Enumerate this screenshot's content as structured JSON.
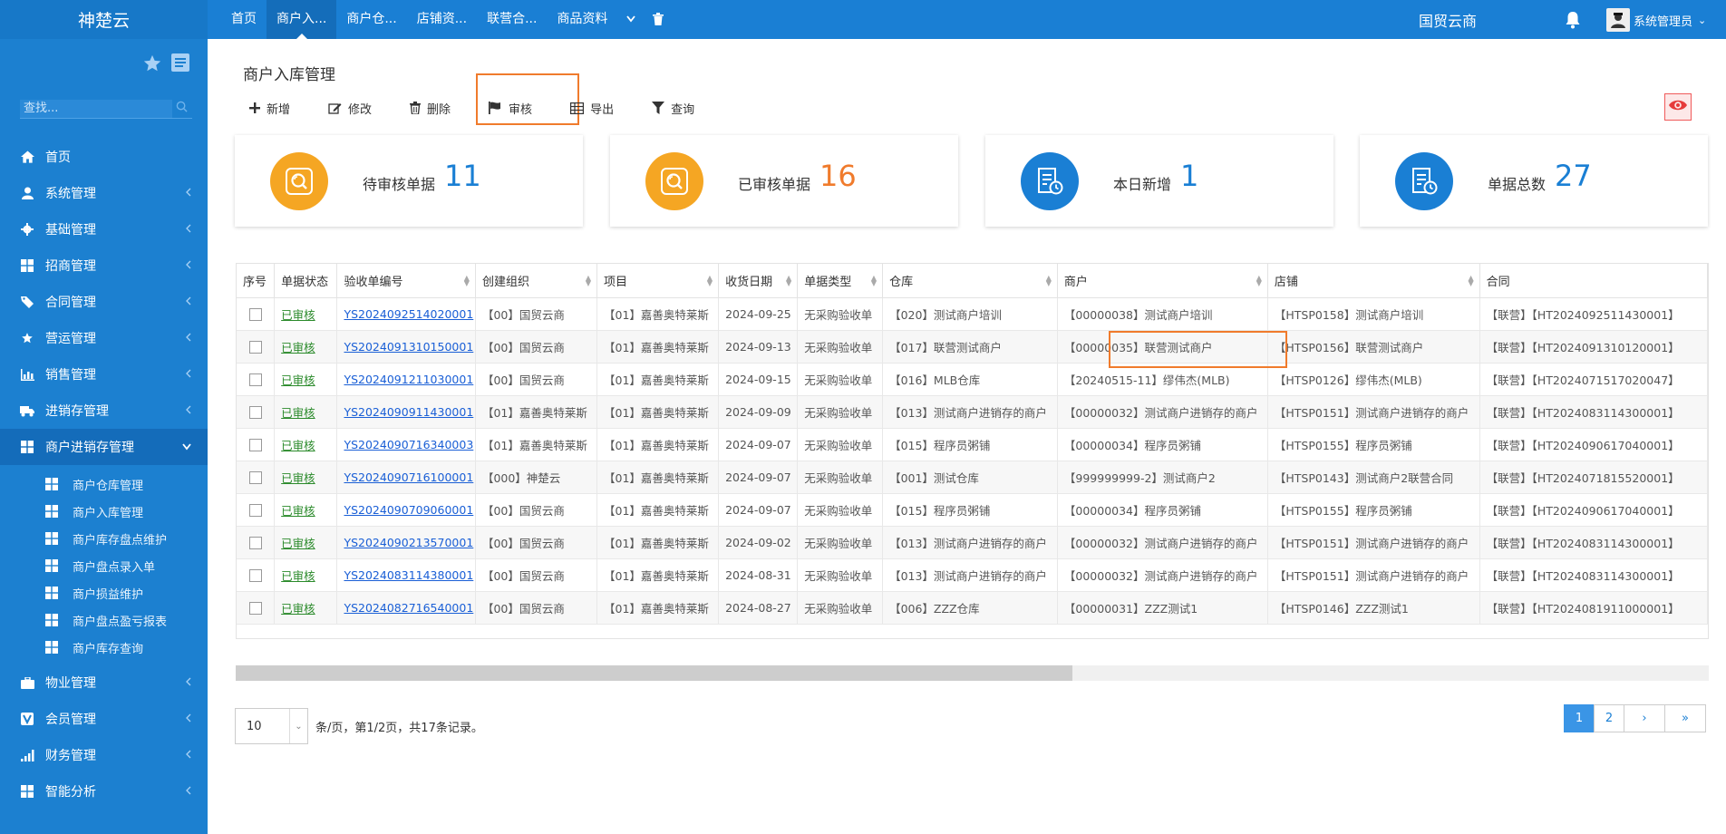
{
  "app": {
    "brand": "神楚云",
    "company": "国贸云商",
    "user": "系统管理员"
  },
  "topnav": {
    "tabs": [
      "首页",
      "商户入...",
      "商户仓...",
      "店铺资...",
      "联营合...",
      "商品资料"
    ],
    "active_index": 1
  },
  "sidebar": {
    "search_placeholder": "查找...",
    "menu": [
      {
        "label": "首页",
        "icon": "home-icon"
      },
      {
        "label": "系统管理",
        "icon": "user-icon"
      },
      {
        "label": "基础管理",
        "icon": "gear-icon"
      },
      {
        "label": "招商管理",
        "icon": "windows-icon"
      },
      {
        "label": "合同管理",
        "icon": "tag-icon"
      },
      {
        "label": "营运管理",
        "icon": "star-icon"
      },
      {
        "label": "销售管理",
        "icon": "bar-chart-icon"
      },
      {
        "label": "进销存管理",
        "icon": "truck-icon"
      },
      {
        "label": "商户进销存管理",
        "icon": "windows-icon"
      }
    ],
    "submenu": [
      "商户仓库管理",
      "商户入库管理",
      "商户库存盘点维护",
      "商户盘点录入单",
      "商户损益维护",
      "商户盘点盈亏报表",
      "商户库存查询"
    ],
    "menu_after": [
      {
        "label": "物业管理",
        "icon": "briefcase-icon"
      },
      {
        "label": "会员管理",
        "icon": "vip-icon"
      },
      {
        "label": "财务管理",
        "icon": "signal-icon"
      },
      {
        "label": "智能分析",
        "icon": "windows-icon"
      }
    ]
  },
  "page": {
    "title": "商户入库管理",
    "toolbar": {
      "add": "新增",
      "edit": "修改",
      "delete": "删除",
      "audit": "审核",
      "export": "导出",
      "query": "查询"
    }
  },
  "cards": [
    {
      "label": "待审核单据",
      "value": "11",
      "color": "#f5a623",
      "num_color": "#1a7fd4"
    },
    {
      "label": "已审核单据",
      "value": "16",
      "color": "#f5a623",
      "num_color": "#f07b2c"
    },
    {
      "label": "本日新增",
      "value": "1",
      "color": "#1a7fd4",
      "num_color": "#1a7fd4"
    },
    {
      "label": "单据总数",
      "value": "27",
      "color": "#1a7fd4",
      "num_color": "#1a7fd4"
    }
  ],
  "table": {
    "columns": [
      "序号",
      "单据状态",
      "验收单编号",
      "创建组织",
      "项目",
      "收货日期",
      "单据类型",
      "仓库",
      "商户",
      "店铺",
      "合同"
    ],
    "rows": [
      [
        "已审核",
        "YS2024092514020001",
        "【00】国贸云商",
        "【01】嘉善奥特莱斯",
        "2024-09-25",
        "无采购验收单",
        "【020】测试商户培训",
        "【00000038】测试商户培训",
        "【HTSP0158】测试商户培训",
        "【联营】【HT2024092511430001】"
      ],
      [
        "已审核",
        "YS2024091310150001",
        "【00】国贸云商",
        "【01】嘉善奥特莱斯",
        "2024-09-13",
        "无采购验收单",
        "【017】联营测试商户",
        "【00000035】联营测试商户",
        "【HTSP0156】联营测试商户",
        "【联营】【HT2024091310120001】"
      ],
      [
        "已审核",
        "YS2024091211030001",
        "【00】国贸云商",
        "【01】嘉善奥特莱斯",
        "2024-09-15",
        "无采购验收单",
        "【016】MLB仓库",
        "【20240515-11】缪伟杰(MLB)",
        "【HTSP0126】缪伟杰(MLB)",
        "【联营】【HT2024071517020047】"
      ],
      [
        "已审核",
        "YS2024090911430001",
        "【01】嘉善奥特莱斯",
        "【01】嘉善奥特莱斯",
        "2024-09-09",
        "无采购验收单",
        "【013】测试商户进销存的商户",
        "【00000032】测试商户进销存的商户",
        "【HTSP0151】测试商户进销存的商户",
        "【联营】【HT2024083114300001】"
      ],
      [
        "已审核",
        "YS2024090716340003",
        "【01】嘉善奥特莱斯",
        "【01】嘉善奥特莱斯",
        "2024-09-07",
        "无采购验收单",
        "【015】程序员粥铺",
        "【00000034】程序员粥铺",
        "【HTSP0155】程序员粥铺",
        "【联营】【HT2024090617040001】"
      ],
      [
        "已审核",
        "YS2024090716100001",
        "【000】神楚云",
        "【01】嘉善奥特莱斯",
        "2024-09-07",
        "无采购验收单",
        "【001】测试仓库",
        "【999999999-2】测试商户2",
        "【HTSP0143】测试商户2联营合同",
        "【联营】【HT2024071815520001】"
      ],
      [
        "已审核",
        "YS2024090709060001",
        "【00】国贸云商",
        "【01】嘉善奥特莱斯",
        "2024-09-07",
        "无采购验收单",
        "【015】程序员粥铺",
        "【00000034】程序员粥铺",
        "【HTSP0155】程序员粥铺",
        "【联营】【HT2024090617040001】"
      ],
      [
        "已审核",
        "YS2024090213570001",
        "【00】国贸云商",
        "【01】嘉善奥特莱斯",
        "2024-09-02",
        "无采购验收单",
        "【013】测试商户进销存的商户",
        "【00000032】测试商户进销存的商户",
        "【HTSP0151】测试商户进销存的商户",
        "【联营】【HT2024083114300001】"
      ],
      [
        "已审核",
        "YS2024083114380001",
        "【00】国贸云商",
        "【01】嘉善奥特莱斯",
        "2024-08-31",
        "无采购验收单",
        "【013】测试商户进销存的商户",
        "【00000032】测试商户进销存的商户",
        "【HTSP0151】测试商户进销存的商户",
        "【联营】【HT2024083114300001】"
      ],
      [
        "已审核",
        "YS2024082716540001",
        "【00】国贸云商",
        "【01】嘉善奥特莱斯",
        "2024-08-27",
        "无采购验收单",
        "【006】ZZZ仓库",
        "【00000031】ZZZ测试1",
        "【HTSP0146】ZZZ测试1",
        "【联营】【HT2024081911000001】"
      ]
    ]
  },
  "pager": {
    "page_size": "10",
    "info": "条/页，第1/2页，共17条记录。",
    "pages": [
      "1",
      "2",
      "›",
      "»"
    ]
  }
}
